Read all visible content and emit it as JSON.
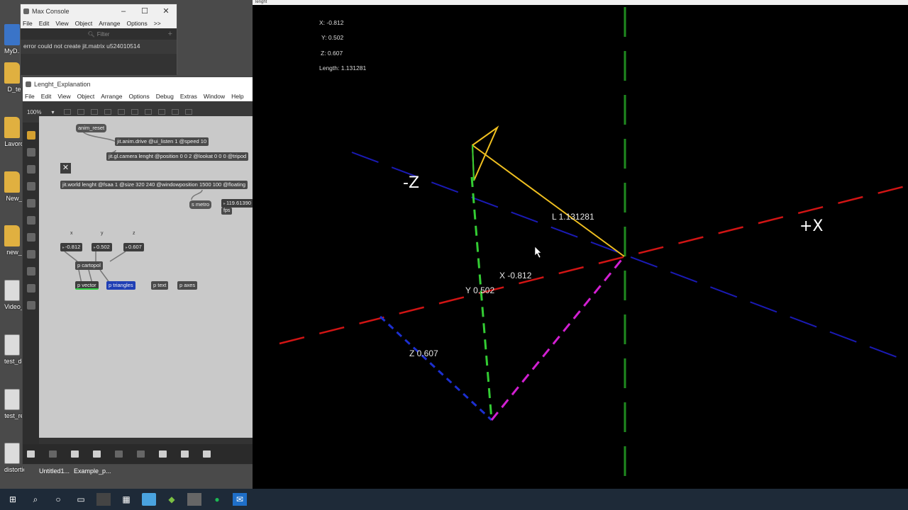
{
  "desktop": {
    "icons": [
      {
        "label": "MyD... Shor",
        "type": "shortcut"
      },
      {
        "label": "D_te",
        "type": "folder"
      },
      {
        "label": "Lavoro",
        "type": "folder"
      },
      {
        "label": "New_",
        "type": "folder"
      },
      {
        "label": "new_",
        "type": "folder"
      },
      {
        "label": "Video_",
        "type": "file"
      },
      {
        "label": "test_de",
        "type": "file"
      },
      {
        "label": "test_re",
        "type": "file"
      },
      {
        "label": "distortion_...",
        "type": "file"
      }
    ],
    "bottom_labels": [
      "Untitled1...",
      "Example_p..."
    ]
  },
  "console": {
    "title": "Max Console",
    "menu": [
      "File",
      "Edit",
      "View",
      "Object",
      "Arrange",
      "Options",
      ">>"
    ],
    "filter_placeholder": "Filter",
    "message": "error could not create jit.matrix u524010514"
  },
  "patcher": {
    "title": "Lenght_Explanation",
    "menu": [
      "File",
      "Edit",
      "View",
      "Object",
      "Arrange",
      "Options",
      "Debug",
      "Extras",
      "Window",
      "Help"
    ],
    "zoom": "100%",
    "objects": {
      "anim_reset": "anim_reset",
      "anim_drive": "jit.anim.drive @ui_listen 1 @speed 10",
      "camera": "jit.gl.camera lenght @position 0 0 2 @lookat 0 0 0 @tripod",
      "world": "jit.world lenght @fsaa 1 @size 320 240 @windowposition 1500 100 @floating",
      "smetro": "s metro",
      "fps_value": "119.61390",
      "fps_label": "fps",
      "label_x": "x",
      "label_y": "y",
      "label_z": "z",
      "num_x": "-0.812",
      "num_y": "0.502",
      "num_z": "0.607",
      "cartopol": "p cartopol",
      "vector": "p vector",
      "triangles": "p triangles",
      "text": "p text",
      "axes": "p axes"
    }
  },
  "gl": {
    "window_title": "lenght",
    "readout": {
      "x": "X: -0.812",
      "y": "Y: 0.502",
      "z": "Z: 0.607",
      "length": "Length: 1.131281"
    },
    "labels": {
      "neg_z": "-Z",
      "pos_x": "+X",
      "length": "L 1.131281",
      "x": "X -0.812",
      "y": "Y 0.502",
      "z": "Z 0.607"
    },
    "colors": {
      "x_axis": "#d11414",
      "y_axis": "#1f8a1f",
      "z_axis": "#1a1ab4",
      "vector": "#f0c020",
      "y_component": "#33cc33",
      "magenta": "#d21fd2",
      "z_component": "#1c2fd0"
    }
  }
}
